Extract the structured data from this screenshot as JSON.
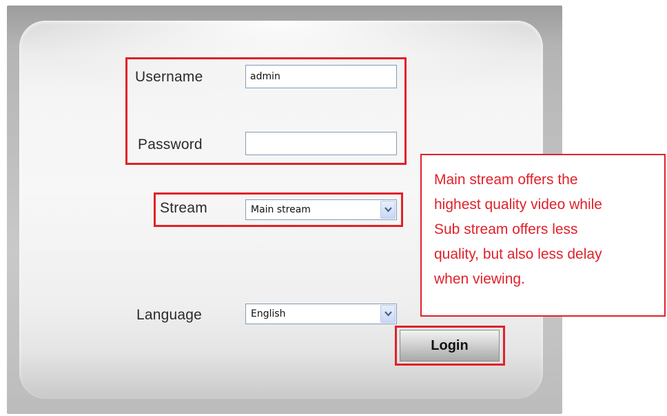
{
  "form": {
    "username_label": "Username",
    "username_value": "admin",
    "password_label": "Password",
    "password_value": "",
    "stream_label": "Stream",
    "stream_selected": "Main stream",
    "language_label": "Language",
    "language_selected": "English",
    "login_label": "Login"
  },
  "callout": {
    "lines": [
      "Main stream offers the",
      "highest quality video while",
      "Sub stream offers less",
      "quality, but also less delay",
      "when viewing."
    ]
  },
  "colors": {
    "highlight_red": "#e0212a",
    "callout_text": "#e0212a",
    "field_border": "#7f9db9"
  },
  "icons": {
    "dropdown": "chevron-down-icon"
  }
}
